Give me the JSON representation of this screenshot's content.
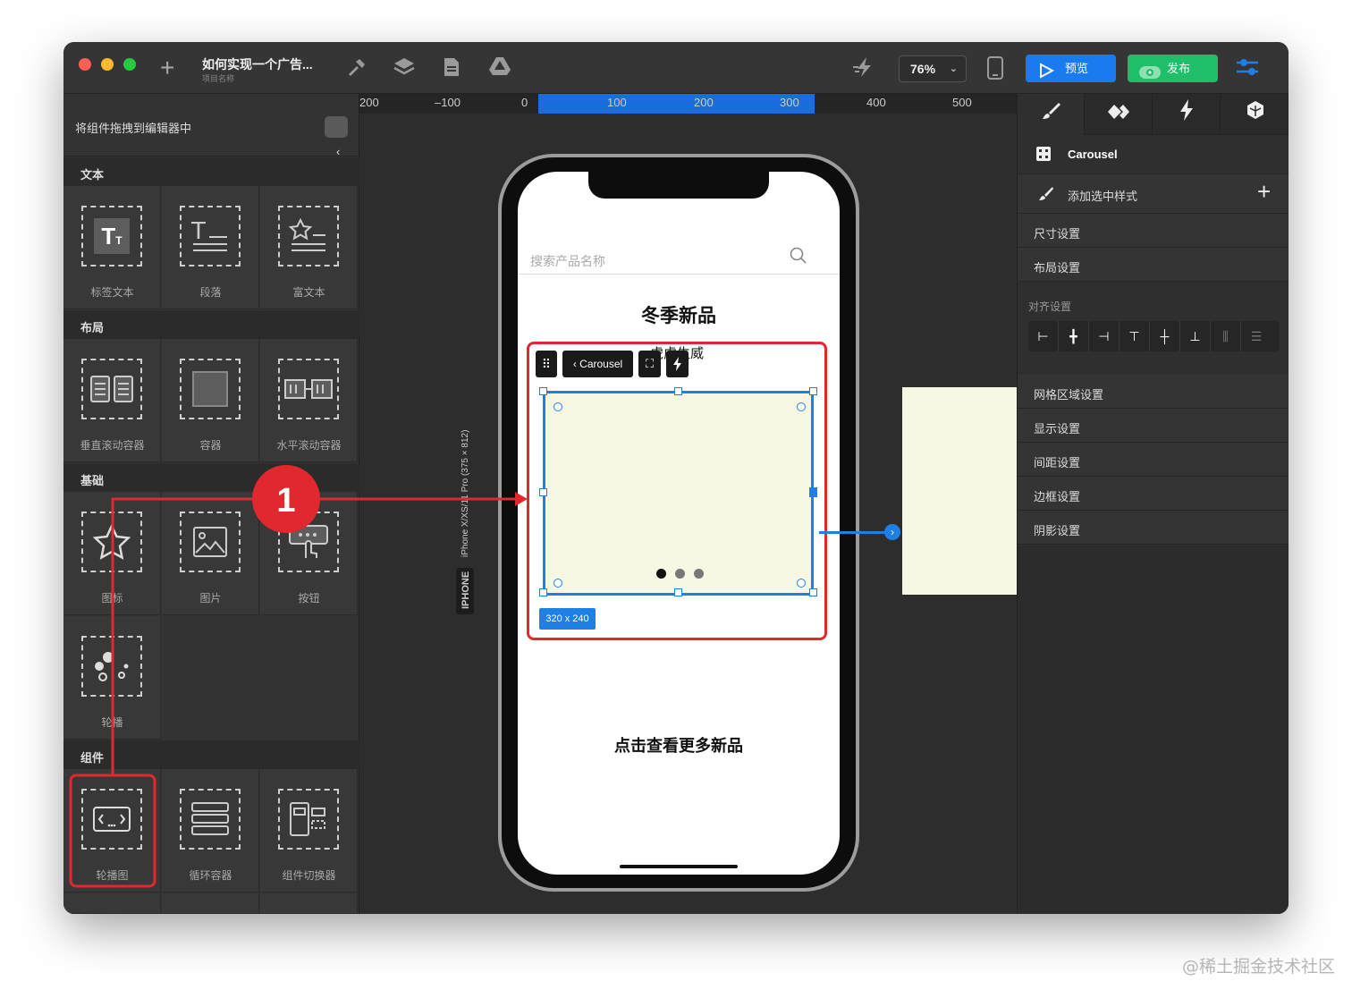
{
  "window": {
    "project_title": "如何实现一个广告...",
    "project_subtitle": "项目名称",
    "zoom": "76%",
    "preview_label": "预览",
    "publish_label": "发布"
  },
  "left_panel": {
    "header": "将组件拖拽到编辑器中",
    "sections": {
      "text": "文本",
      "layout": "布局",
      "basic": "基础",
      "components": "组件"
    },
    "items": {
      "label_text": "标签文本",
      "paragraph": "段落",
      "rich_text": "富文本",
      "vertical_scroll": "垂直滚动容器",
      "container": "容器",
      "horizontal_scroll": "水平滚动容器",
      "icon": "图标",
      "image": "图片",
      "button": "按钮",
      "carousel_basic": "轮播",
      "carousel": "轮播图",
      "loop_container": "循环容器",
      "component_switcher": "组件切换器"
    }
  },
  "ruler": {
    "ticks": [
      "200",
      "–100",
      "0",
      "100",
      "200",
      "300",
      "400",
      "500"
    ]
  },
  "device": {
    "vertical_label": "iPhone X/XS/11 Pro (375 × 812)",
    "type_label": "IPHONE",
    "search_placeholder": "搜索产品名称",
    "heading": "冬季新品",
    "carousel_text": "虎虎生威",
    "toolbar_label": "Carousel",
    "size_badge": "320 x 240",
    "more_link": "点击查看更多新品",
    "pagination": {
      "count": 3,
      "active": 1
    }
  },
  "annotation": {
    "step": "1",
    "color": "#e0282e"
  },
  "right_panel": {
    "component_name": "Carousel",
    "add_style": "添加选中样式",
    "size_settings": "尺寸设置",
    "layout_settings": "布局设置",
    "align_settings": "对齐设置",
    "grid_settings": "网格区域设置",
    "display_settings": "显示设置",
    "spacing_settings": "间距设置",
    "border_settings": "边框设置",
    "shadow_settings": "阴影设置"
  },
  "colors": {
    "accent_blue": "#1e7fe6",
    "preview_button": "#1a7bf0",
    "publish_button": "#1fbf6a",
    "carousel_bg": "#f6f8e3"
  },
  "watermark": "@稀土掘金技术社区"
}
